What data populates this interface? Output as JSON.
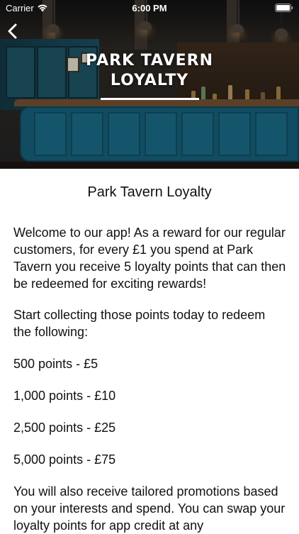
{
  "status_bar": {
    "carrier": "Carrier",
    "time": "6:00 PM"
  },
  "hero": {
    "title_line1": "PARK TAVERN",
    "title_line2": "LOYALTY"
  },
  "content": {
    "title": "Park Tavern Loyalty",
    "paragraphs": [
      "Welcome to our app! As a reward for our regular customers, for every £1 you spend at Park Tavern you receive 5 loyalty points that can then be redeemed for exciting rewards!",
      "Start collecting those points today to redeem the following:",
      "500 points - £5",
      "1,000 points - £10",
      "2,500 points - £25",
      "5,000 points -  £75",
      "You will also receive tailored promotions based on your interests and spend. You can swap your loyalty points for app credit at any"
    ]
  },
  "icons": {
    "back": "chevron-left-icon",
    "wifi": "wifi-icon",
    "battery": "battery-icon"
  },
  "colors": {
    "status_text": "#ffffff",
    "body_text": "#111111",
    "counter_blue": "#145a73"
  }
}
